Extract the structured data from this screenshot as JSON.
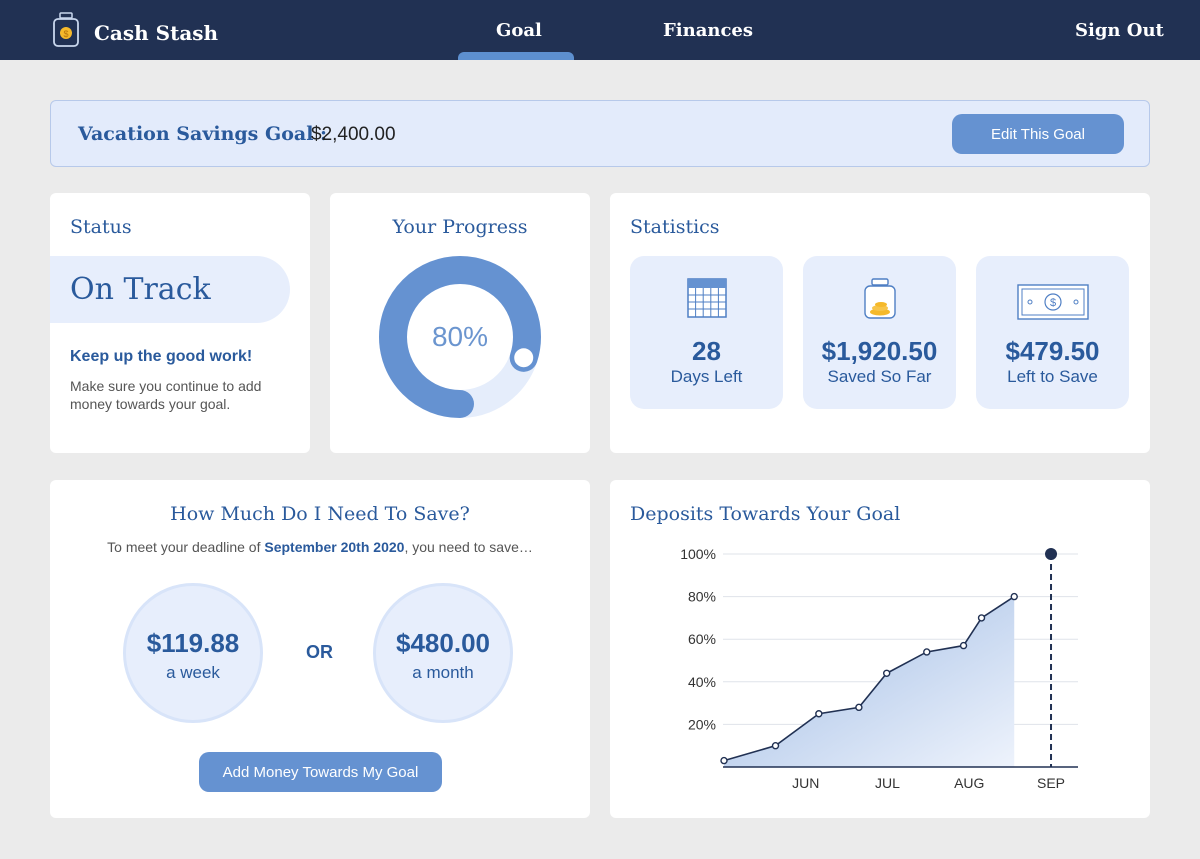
{
  "nav": {
    "brand": "Cash Stash",
    "links": [
      "Goal",
      "Finances"
    ],
    "active": "Goal",
    "sign_out": "Sign Out"
  },
  "goal": {
    "title": "Vacation Savings Goal :",
    "amount": "$2,400.00",
    "edit_label": "Edit This Goal"
  },
  "status": {
    "title": "Status",
    "value": "On Track",
    "headline": "Keep up the good work!",
    "message": "Make sure you continue to add money towards your goal."
  },
  "progress": {
    "title": "Your Progress",
    "percent_label": "80%",
    "fraction": 0.8
  },
  "statistics": {
    "title": "Statistics",
    "items": [
      {
        "value": "28",
        "label": "Days Left",
        "icon": "calendar-icon"
      },
      {
        "value": "$1,920.50",
        "label": "Saved So Far",
        "icon": "coin-jar-icon"
      },
      {
        "value": "$479.50",
        "label": "Left to Save",
        "icon": "dollar-bill-icon"
      }
    ]
  },
  "save": {
    "title": "How Much Do I Need To Save?",
    "sub_prefix": "To meet your deadline of",
    "deadline": "September 20th 2020",
    "sub_suffix": ", you need to save…",
    "week_amount": "$119.88",
    "week_label": "a week",
    "or": "OR",
    "month_amount": "$480.00",
    "month_label": "a month",
    "button": "Add Money Towards My Goal"
  },
  "colors": {
    "nav": "#213153",
    "accent": "#6592d1",
    "primary_text": "#2a5a9c",
    "light_fill": "#e7eefc"
  },
  "chart_data": {
    "type": "area",
    "title": "Deposits Towards Your Goal",
    "x_ticks": [
      "JUN",
      "JUL",
      "AUG",
      "SEP"
    ],
    "y_ticks": [
      "20%",
      "40%",
      "60%",
      "80%",
      "100%"
    ],
    "ylim": [
      0,
      100
    ],
    "xlim": [
      0,
      4.33
    ],
    "grid": true,
    "points": [
      {
        "x": 0.0,
        "y": 3
      },
      {
        "x": 0.63,
        "y": 10
      },
      {
        "x": 1.16,
        "y": 25
      },
      {
        "x": 1.65,
        "y": 28
      },
      {
        "x": 1.99,
        "y": 44
      },
      {
        "x": 2.48,
        "y": 54
      },
      {
        "x": 2.93,
        "y": 57
      },
      {
        "x": 3.15,
        "y": 70
      },
      {
        "x": 3.55,
        "y": 80
      }
    ],
    "goal_point": {
      "x": 4.0,
      "y": 100
    }
  }
}
